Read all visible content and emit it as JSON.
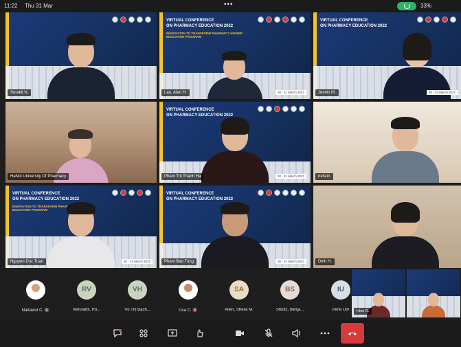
{
  "status_bar": {
    "time": "11:22",
    "date": "Thu 31 Mar",
    "battery": "33%"
  },
  "conference": {
    "title_line1": "VIRTUAL CONFERENCE",
    "title_line2": "ON PHARMACY EDUCATION 2022",
    "subtitle": "INNOVATION TO TRANSFORM PHARMACY HIGHER EDUCATION PROGRAM",
    "date_tag": "30 - 31 March 2022"
  },
  "tiles": [
    {
      "name": "Surakit N."
    },
    {
      "name": "Lau, Alan H."
    },
    {
      "name": "Jennis M."
    },
    {
      "name": "HaNoi University Of Pharmacy"
    },
    {
      "name": "Pham Thi Thanh Ha"
    },
    {
      "name": "nelson"
    },
    {
      "name": "Nguyen Duc Tuan"
    },
    {
      "name": "Pham Bao Tung"
    },
    {
      "name": "Dinh H."
    }
  ],
  "strip": [
    {
      "initials": "",
      "name": "Nattawut C.",
      "color": "#ffffff"
    },
    {
      "initials": "RV",
      "name": "Vellurattil, Ro...",
      "color": "#c9d3c0"
    },
    {
      "initials": "VH",
      "name": "Võ Thị Bạch...",
      "color": "#c9d3c0"
    },
    {
      "initials": "",
      "name": "Usa C.",
      "color": "#ffffff"
    },
    {
      "initials": "SA",
      "name": "Allen, Sheila M.",
      "color": "#e9ddc4"
    },
    {
      "initials": "BS",
      "name": "Shultz, Benja...",
      "color": "#e6dcd6"
    },
    {
      "initials": "IU",
      "name": "Irene Um",
      "color": "#d8dee8"
    }
  ],
  "mini_tiles": [
    {
      "name": "Hien D."
    },
    {
      "name": ""
    }
  ],
  "controls": {
    "chat_icon": "chat-bubble-icon",
    "participants_icon": "participants-icon",
    "share_icon": "share-screen-icon",
    "reactions_icon": "reactions-icon",
    "camera_icon": "video-camera-icon",
    "mic_icon": "microphone-muted-icon",
    "speaker_icon": "speaker-icon",
    "more_icon": "more-options-icon",
    "hangup_icon": "hang-up-icon"
  },
  "colors": {
    "background": "#1e1e1e",
    "active_speaker": "#e5c84a",
    "hangup": "#d63a3a",
    "call_indicator": "#2fb36a"
  }
}
